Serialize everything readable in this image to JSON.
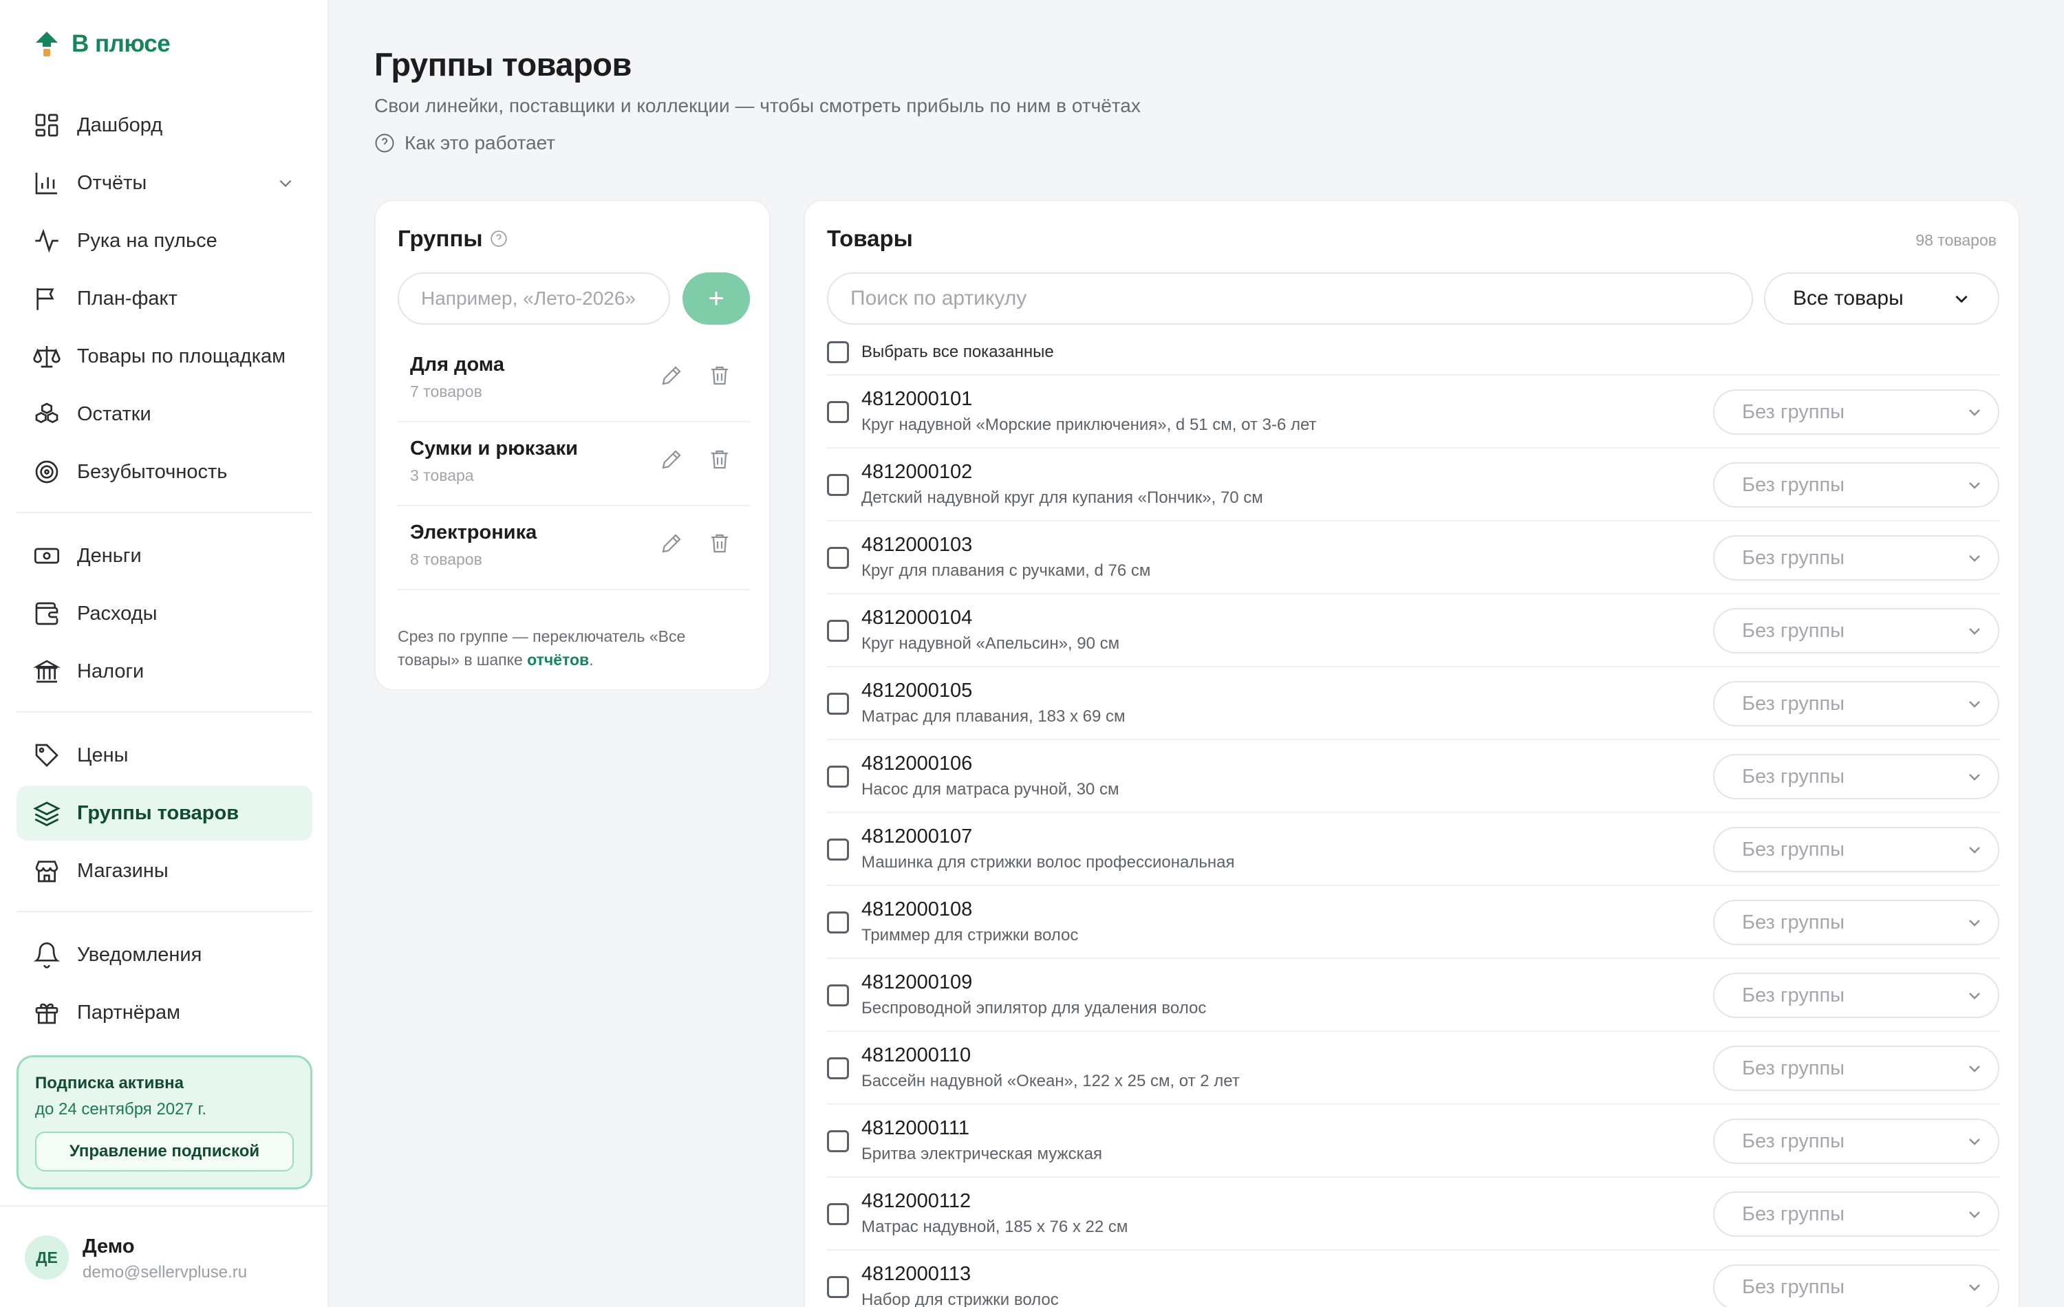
{
  "app": {
    "logo_text": "В плюсе",
    "accent": "#17855a"
  },
  "sidebar": {
    "items": [
      {
        "label": "Дашборд",
        "icon": "dashboard-icon"
      },
      {
        "label": "Отчёты",
        "icon": "bar-chart-icon",
        "has_chevron": true
      },
      {
        "label": "Рука на пульсе",
        "icon": "pulse-icon"
      },
      {
        "label": "План-факт",
        "icon": "flag-icon"
      },
      {
        "label": "Товары по площадкам",
        "icon": "scales-icon"
      },
      {
        "label": "Остатки",
        "icon": "boxes-icon"
      },
      {
        "label": "Безубыточность",
        "icon": "target-icon"
      },
      {
        "label": "Деньги",
        "icon": "banknote-icon"
      },
      {
        "label": "Расходы",
        "icon": "wallet-icon"
      },
      {
        "label": "Налоги",
        "icon": "bank-icon"
      },
      {
        "label": "Цены",
        "icon": "tag-icon"
      },
      {
        "label": "Группы товаров",
        "icon": "layers-icon",
        "active": true
      },
      {
        "label": "Магазины",
        "icon": "store-icon"
      },
      {
        "label": "Уведомления",
        "icon": "bell-icon"
      },
      {
        "label": "Партнёрам",
        "icon": "gift-icon"
      }
    ],
    "subscription": {
      "status": "Подписка активна",
      "until": "до 24 сентября 2027 г.",
      "button": "Управление подпиской"
    },
    "user": {
      "initials": "ДЕ",
      "name": "Демо",
      "email": "demo@sellervpluse.ru"
    }
  },
  "header": {
    "title": "Группы товаров",
    "subtitle": "Свои линейки, поставщики и коллекции — чтобы смотреть прибыль по ним в отчётах",
    "howto": "Как это работает"
  },
  "groups": {
    "title": "Группы",
    "input_placeholder": "Например, «Лето-2026»",
    "add_label": "+",
    "list": [
      {
        "name": "Для дома",
        "count": "7 товаров"
      },
      {
        "name": "Сумки и рюкзаки",
        "count": "3 товара"
      },
      {
        "name": "Электроника",
        "count": "8 товаров"
      }
    ],
    "note_prefix": "Срез по группе — переключатель «Все товары» в шапке ",
    "note_link": "отчётов",
    "note_suffix": "."
  },
  "products": {
    "title": "Товары",
    "count": "98 товаров",
    "search_placeholder": "Поиск по артикулу",
    "filter_value": "Все товары",
    "select_all": "Выбрать все показанные",
    "no_group": "Без группы",
    "rows": [
      {
        "sku": "4812000101",
        "name": "Круг надувной «Морские приключения», d 51 см, от 3-6 лет"
      },
      {
        "sku": "4812000102",
        "name": "Детский надувной круг для купания «Пончик», 70 см"
      },
      {
        "sku": "4812000103",
        "name": "Круг для плавания с ручками, d 76 см"
      },
      {
        "sku": "4812000104",
        "name": "Круг надувной «Апельсин», 90 см"
      },
      {
        "sku": "4812000105",
        "name": "Матрас для плавания, 183 х 69 см"
      },
      {
        "sku": "4812000106",
        "name": "Насос для матраса ручной, 30 см"
      },
      {
        "sku": "4812000107",
        "name": "Машинка для стрижки волос профессиональная"
      },
      {
        "sku": "4812000108",
        "name": "Триммер для стрижки волос"
      },
      {
        "sku": "4812000109",
        "name": "Беспроводной эпилятор для удаления волос"
      },
      {
        "sku": "4812000110",
        "name": "Бассейн надувной «Океан», 122 х 25 см, от 2 лет"
      },
      {
        "sku": "4812000111",
        "name": "Бритва электрическая мужская"
      },
      {
        "sku": "4812000112",
        "name": "Матрас надувной, 185 х 76 х 22 см"
      },
      {
        "sku": "4812000113",
        "name": "Набор для стрижки волос"
      }
    ]
  }
}
